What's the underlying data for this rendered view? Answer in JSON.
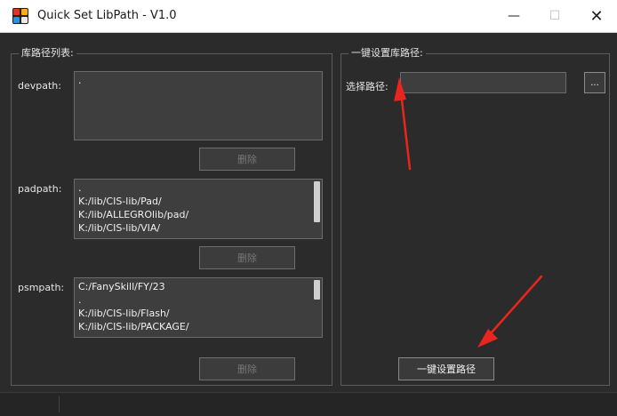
{
  "window": {
    "title": "Quick Set LibPath - V1.0",
    "min_glyph": "—",
    "max_glyph": "☐",
    "close_glyph": "✕"
  },
  "left_group": {
    "title": "库路径列表:",
    "devpath": {
      "label": "devpath:",
      "items": [
        "."
      ],
      "delete_label": "删除"
    },
    "padpath": {
      "label": "padpath:",
      "items": [
        ".",
        "K:/lib/CIS-lib/Pad/",
        "K:/lib/ALLEGROlib/pad/",
        "K:/lib/CIS-lib/VIA/"
      ],
      "delete_label": "删除"
    },
    "psmpath": {
      "label": "psmpath:",
      "items": [
        "C:/FanySkill/FY/23",
        ".",
        "K:/lib/CIS-lib/Flash/",
        "K:/lib/CIS-lib/PACKAGE/"
      ],
      "delete_label": "删除"
    }
  },
  "right_group": {
    "title": "一键设置库路径:",
    "select_label": "选择路径:",
    "path_value": "",
    "browse_label": "...",
    "set_button_label": "一键设置路径"
  },
  "colors": {
    "annotation_arrow": "#e8261e",
    "background": "#2b2b2b"
  }
}
